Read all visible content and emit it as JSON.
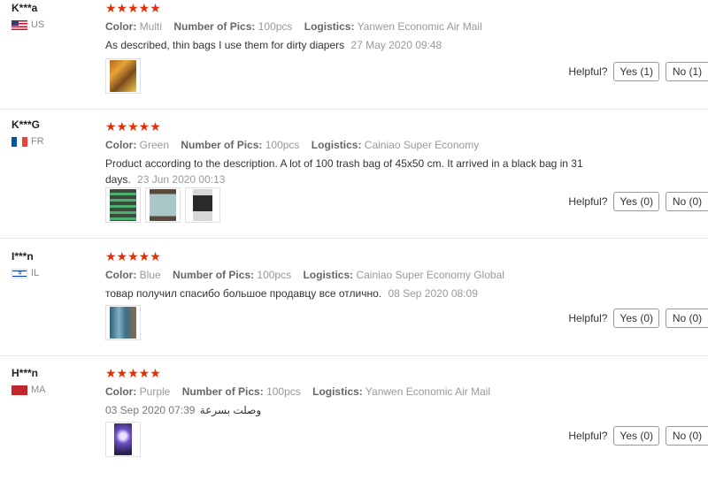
{
  "labels": {
    "color": "Color:",
    "pics": "Number of Pics:",
    "logistics": "Logistics:",
    "helpful": "Helpful?"
  },
  "stars": "★★★★★",
  "reviews": [
    {
      "user": "K***a",
      "country": "US",
      "flag": "us",
      "color": "Multi",
      "pics": "100pcs",
      "logistics": "Yanwen Economic Air Mail",
      "text": "As described, thin bags I use them for dirty diapers",
      "date": "27 May 2020 09:48",
      "photos": 1,
      "yes": "Yes (1)",
      "no": "No (1)"
    },
    {
      "user": "K***G",
      "country": "FR",
      "flag": "fr",
      "color": "Green",
      "pics": "100pcs",
      "logistics": "Cainiao Super Economy",
      "text": "Product according to the description. A lot of 100 trash bag of 45x50 cm. It arrived in a black bag in 31 days.",
      "date": "23 Jun 2020 00:13",
      "photos": 3,
      "yes": "Yes (0)",
      "no": "No (0)"
    },
    {
      "user": "I***n",
      "country": "IL",
      "flag": "il",
      "color": "Blue",
      "pics": "100pcs",
      "logistics": "Cainiao Super Economy Global",
      "text": "товар получил спасибо большое продавцу все отлично.",
      "date": "08 Sep 2020 08:09",
      "photos": 1,
      "yes": "Yes (0)",
      "no": "No (0)"
    },
    {
      "user": "H***n",
      "country": "MA",
      "flag": "ma",
      "color": "Purple",
      "pics": "100pcs",
      "logistics": "Yanwen Economic Air Mail",
      "text": "وصلت بسرعة",
      "date": "03 Sep 2020 07:39",
      "photos": 1,
      "yes": "Yes (0)",
      "no": "No (0)"
    }
  ],
  "colors": {
    "star": "#e62e04",
    "divider": "#e6e6e6"
  }
}
